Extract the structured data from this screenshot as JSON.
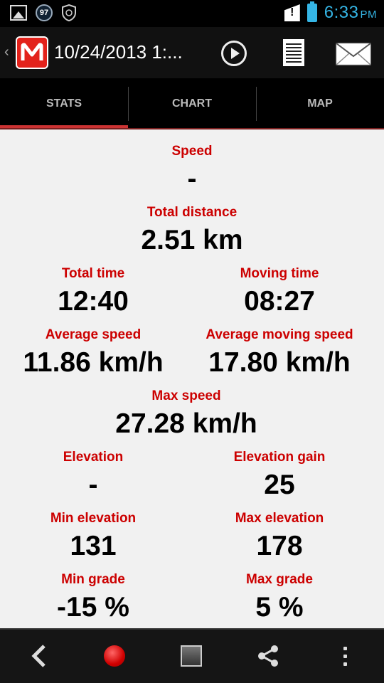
{
  "status_bar": {
    "notification_count": "97",
    "time": "6:33",
    "ampm": "PM",
    "accent_color": "#35b5e5"
  },
  "action_bar": {
    "title": "10/24/2013 1:...",
    "icons": [
      "app-logo-icon",
      "play-icon",
      "document-icon",
      "mail-icon"
    ]
  },
  "tabs": [
    {
      "label": "STATS",
      "selected": true
    },
    {
      "label": "CHART",
      "selected": false
    },
    {
      "label": "MAP",
      "selected": false
    }
  ],
  "stats": {
    "speed": {
      "label": "Speed",
      "value": "-"
    },
    "total_distance": {
      "label": "Total distance",
      "value": "2.51 km"
    },
    "total_time": {
      "label": "Total time",
      "value": "12:40"
    },
    "moving_time": {
      "label": "Moving time",
      "value": "08:27"
    },
    "average_speed": {
      "label": "Average speed",
      "value": "11.86 km/h"
    },
    "average_moving_speed": {
      "label": "Average moving speed",
      "value": "17.80 km/h"
    },
    "max_speed": {
      "label": "Max speed",
      "value": "27.28 km/h"
    },
    "elevation": {
      "label": "Elevation",
      "value": "-"
    },
    "elevation_gain": {
      "label": "Elevation gain",
      "value": "25"
    },
    "min_elevation": {
      "label": "Min elevation",
      "value": "131"
    },
    "max_elevation": {
      "label": "Max elevation",
      "value": "178"
    },
    "min_grade": {
      "label": "Min grade",
      "value": "-15 %"
    },
    "max_grade": {
      "label": "Max grade",
      "value": "5 %"
    }
  },
  "colors": {
    "label_red": "#cc0000",
    "tab_indicator": "#cc3333",
    "content_bg": "#f1f1f1"
  },
  "bottom_bar": {
    "icons": [
      "back-icon",
      "record-icon",
      "stop-icon",
      "share-icon",
      "overflow-menu-icon"
    ]
  }
}
